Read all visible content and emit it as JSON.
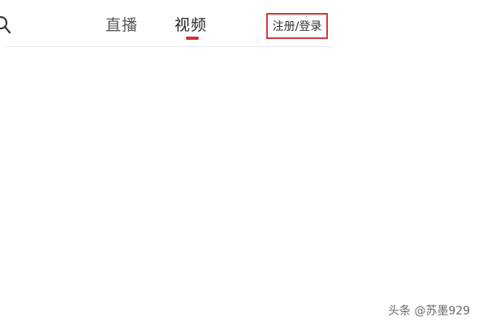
{
  "top_nav": {
    "search_icon": "search-icon",
    "tabs": [
      {
        "label": "直播",
        "active": false
      },
      {
        "label": "视频",
        "active": true
      }
    ],
    "active_underline_color": "#d0314a",
    "login_button": {
      "label": "注册/登录",
      "highlight_color": "#d23a3a"
    }
  },
  "watermark": {
    "text": "头条 @苏墨929"
  }
}
